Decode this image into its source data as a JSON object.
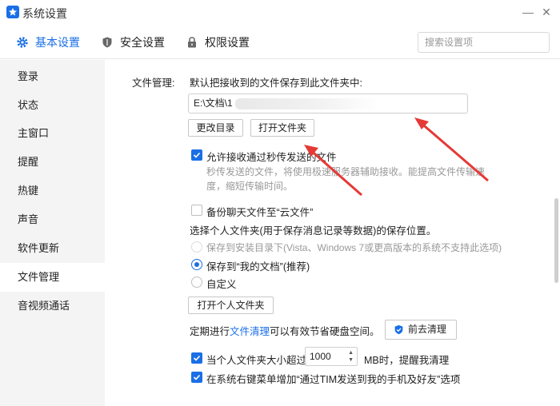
{
  "window": {
    "title": "系统设置",
    "minimize": "—",
    "close": "✕"
  },
  "tabs": [
    {
      "label": "基本设置",
      "icon": "gear-icon",
      "active": true
    },
    {
      "label": "安全设置",
      "icon": "shield-icon",
      "active": false
    },
    {
      "label": "权限设置",
      "icon": "lock-icon",
      "active": false
    }
  ],
  "search": {
    "placeholder": "搜索设置项"
  },
  "sidebar": {
    "items": [
      {
        "label": "登录"
      },
      {
        "label": "状态"
      },
      {
        "label": "主窗口"
      },
      {
        "label": "提醒"
      },
      {
        "label": "热键"
      },
      {
        "label": "声音"
      },
      {
        "label": "软件更新"
      },
      {
        "label": "文件管理",
        "active": true
      },
      {
        "label": "音视频通话"
      }
    ]
  },
  "file_mgmt": {
    "section_label": "文件管理:",
    "save_hint": "默认把接收到的文件保存到此文件夹中:",
    "path_value": "E:\\文档\\1",
    "change_dir_button": "更改目录",
    "open_folder_button": "打开文件夹",
    "allow_flash_label": "允许接收通过秒传发送的文件",
    "allow_flash_checked": true,
    "allow_flash_desc_line1": "秒传发送的文件，将使用极速服务器辅助接收。能提高文件传输速",
    "allow_flash_desc_line2": "度，缩短传输时间。",
    "backup_cloud_label": "备份聊天文件至“云文件”",
    "backup_cloud_checked": false,
    "personal_folder_label": "选择个人文件夹(用于保存消息记录等数据)的保存位置。",
    "radio_install_dir": "保存到安装目录下(Vista、Windows 7或更高版本的系统不支持此选项)",
    "radio_my_docs": "保存到“我的文档”(推荐)",
    "radio_custom": "自定义",
    "selected_radio": "my_docs",
    "open_personal_button": "打开个人文件夹",
    "cleanup_prefix": "定期进行",
    "cleanup_link": "文件清理",
    "cleanup_suffix": "可以有效节省硬盘空间。",
    "go_cleanup_button": "前去清理",
    "size_limit_prefix": "当个人文件夹大小超过",
    "size_limit_value": "1000",
    "size_limit_suffix": "MB时，提醒我清理",
    "size_limit_checked": true,
    "context_menu_label": "在系统右键菜单增加“通过TIM发送到我的手机及好友”选项",
    "context_menu_checked": true
  },
  "colors": {
    "accent": "#1a6fe6",
    "annotation_arrow": "#e53935"
  }
}
